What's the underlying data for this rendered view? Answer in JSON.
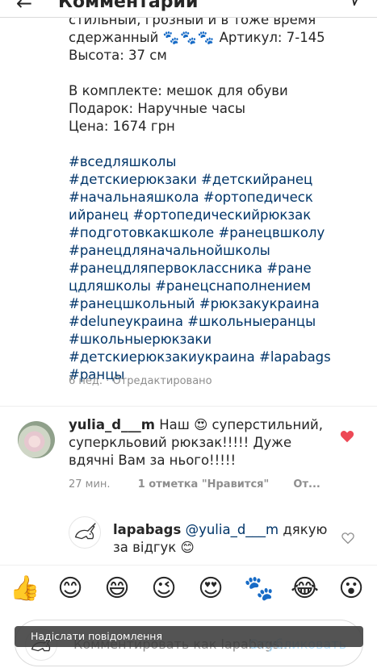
{
  "header": {
    "title": "Комментарии"
  },
  "caption": {
    "line1": "стильный, грозный и в тоже время",
    "line2_prefix": "сдержанный",
    "line2_paws": "🐾🐾🐾",
    "line2_suffix": "Артикул: 7-145",
    "line3": "Высота: 37 см",
    "line4": "В комплекте: мешок для обуви",
    "line5": "Подарок: Наручные часы",
    "line6": "Цена: 1674 грн",
    "hashtag_lines": [
      "#вседляшколы",
      "#детскиерюкзаки #детскийранец",
      "#начальнаяшкола #ортопедическ",
      "ийранец #ортопедическийрюкзак",
      "#подготовкакшколе #ранецвшколу",
      "#ранецдляначальнойшколы",
      "#ранецдляпервоклассника #ране",
      "цдляшколы #ранецснаполнением",
      "#ранецшкольный #рюкзакукраина",
      "#deluneyкраина  #школьныеранцы",
      "#школьныерюкзаки",
      "#детскиерюкзакиукраина #lapabags",
      "#ранцы"
    ],
    "time": "6 нед.",
    "separator": "·",
    "edited": "Отредактировано"
  },
  "comment1": {
    "username": "yulia_d___m",
    "text_before_emoji": "Наш",
    "emoji": "😍",
    "text_after_emoji": "суперстильний, суперкльовий рюкзак!!!!! Дуже вдячні Вам за нього!!!!!",
    "time": "27 мин.",
    "likes": "1 отметка \"Нравится\"",
    "reply": "От...",
    "liked": true
  },
  "comment2": {
    "username": "lapabags",
    "mention": "@yulia_d___m",
    "text": "дякую за відгук",
    "emoji": "😊"
  },
  "emoji_bar": [
    "👍",
    "😊",
    "😄",
    "😉",
    "😍",
    "🐾",
    "😂",
    "😮"
  ],
  "input": {
    "placeholder": "Комментировать как lapabags...",
    "publish": "Опубликовать"
  },
  "toast": {
    "text": "Надіслати повідомлення"
  },
  "colors": {
    "hashtag": "#003569",
    "heart_liked": "#ed4956",
    "meta_gray": "#8e8e8e",
    "publish_disabled": "#b2dffc"
  }
}
